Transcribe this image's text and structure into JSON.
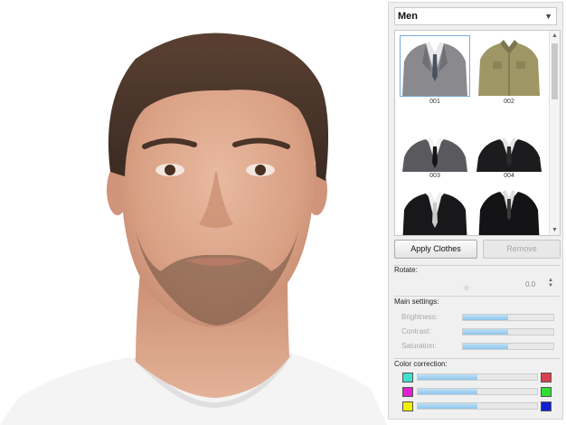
{
  "category": {
    "selected": "Men",
    "dropdown_icon": "chevron-down-icon"
  },
  "gallery": {
    "items": [
      {
        "label": "001",
        "garment": "grey-suit"
      },
      {
        "label": "002",
        "garment": "khaki-shirt"
      },
      {
        "label": "003",
        "garment": "grey-suit-black-tie"
      },
      {
        "label": "004",
        "garment": "black-suit"
      },
      {
        "label": "",
        "garment": "black-suit-white-tie"
      },
      {
        "label": "",
        "garment": "black-suit-dark"
      }
    ]
  },
  "buttons": {
    "apply": "Apply Clothes",
    "remove": "Remove"
  },
  "rotate": {
    "title": "Rotate:",
    "value": "0.0"
  },
  "main_settings": {
    "title": "Main settings:",
    "items": [
      {
        "label": "Brightness:",
        "level": 0.5
      },
      {
        "label": "Contrast:",
        "level": 0.5
      },
      {
        "label": "Saturation:",
        "level": 0.5
      }
    ]
  },
  "color_correction": {
    "title": "Color correction:",
    "rows": [
      {
        "left_color": "#3fe0d0",
        "right_color": "#d94050",
        "level": 0.5
      },
      {
        "left_color": "#e020d0",
        "right_color": "#30e030",
        "level": 0.5
      },
      {
        "left_color": "#f0f000",
        "right_color": "#1020d0",
        "level": 0.5
      }
    ]
  },
  "colors": {
    "accent": "#8ec6ec",
    "panel_bg": "#f0f0f0"
  }
}
